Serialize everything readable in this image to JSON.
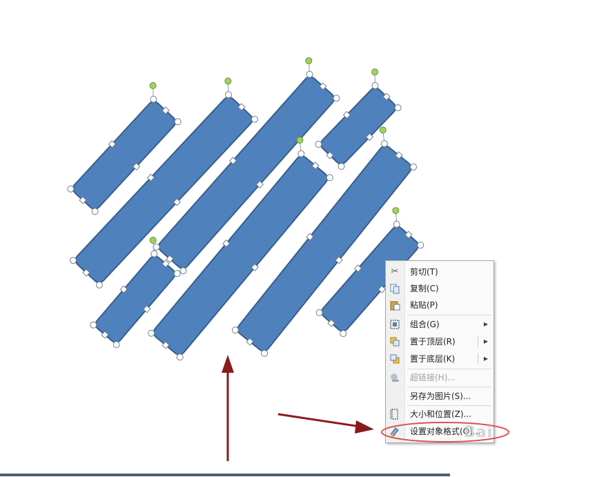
{
  "slide": {
    "background": "#ffffff",
    "shape_fill": "#4f81bd",
    "shape_stroke": "#385d8a",
    "handle_fill": "#ffffff",
    "rotate_handle_fill": "#9bd65a",
    "arrow_color": "#8b1a1a",
    "highlight_ellipse_color": "#d9534f"
  },
  "context_menu": {
    "items": [
      {
        "label": "剪切(T)",
        "icon": "scissors-icon"
      },
      {
        "label": "复制(C)",
        "icon": "copy-icon"
      },
      {
        "label": "粘贴(P)",
        "icon": "paste-icon"
      },
      {
        "label": "组合(G)",
        "icon": "group-icon",
        "submenu": true
      },
      {
        "label": "置于顶层(R)",
        "icon": "bring-to-front-icon",
        "submenu": true
      },
      {
        "label": "置于底层(K)",
        "icon": "send-to-back-icon",
        "submenu": true
      },
      {
        "label": "超链接(H)...",
        "icon": "hyperlink-icon",
        "disabled": true
      },
      {
        "label": "另存为图片(S)...",
        "icon": ""
      },
      {
        "label": "大小和位置(Z)...",
        "icon": "size-position-icon"
      },
      {
        "label": "设置对象格式(O)...",
        "icon": "format-object-icon"
      }
    ]
  },
  "watermark": {
    "text": "Bai"
  }
}
